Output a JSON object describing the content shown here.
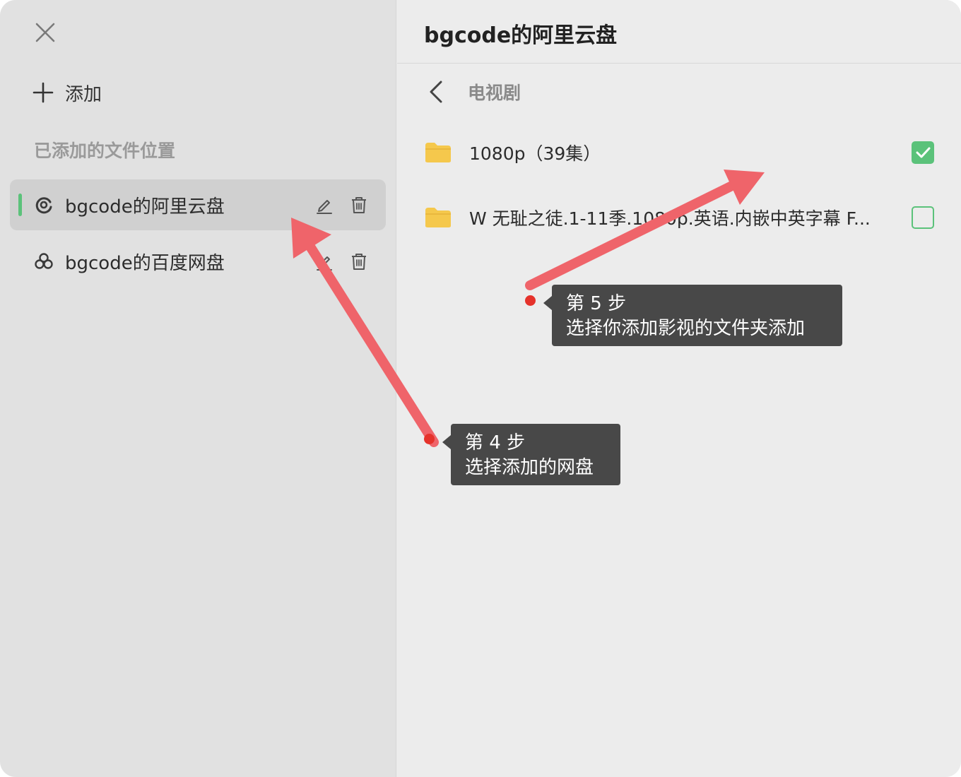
{
  "sidebar": {
    "add_label": "添加",
    "section_title": "已添加的文件位置",
    "locations": [
      {
        "name": "bgcode的阿里云盘",
        "icon": "aliyun-drive-icon",
        "active": true
      },
      {
        "name": "bgcode的百度网盘",
        "icon": "baidu-pan-icon",
        "active": false
      }
    ]
  },
  "main": {
    "title": "bgcode的阿里云盘",
    "breadcrumb": "电视剧",
    "folders": [
      {
        "name": "1080p（39集）",
        "checked": true
      },
      {
        "name": "W 无耻之徒.1-11季.1080p.英语.内嵌中英字幕 F...",
        "checked": false
      }
    ]
  },
  "annotations": {
    "step4_title": "第 4 步",
    "step4_text": "选择添加的网盘",
    "step5_title": "第 5 步",
    "step5_text": "选择你添加影视的文件夹添加"
  },
  "colors": {
    "accent_green": "#5bc27a",
    "arrow_red": "#ef646a",
    "dot_red": "#e5322b",
    "folder_yellow": "#f5c84c",
    "tooltip_bg": "#484848"
  }
}
